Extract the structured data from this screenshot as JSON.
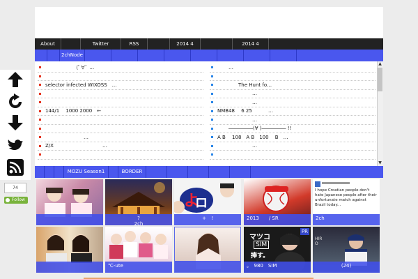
{
  "topnav": [
    "About",
    "",
    "Twitter",
    "RSS",
    "",
    "2014 4",
    "",
    "2014 4",
    ""
  ],
  "subnav": [
    "",
    "",
    "2chNode",
    "",
    "",
    "",
    "",
    "",
    "",
    "",
    "",
    ""
  ],
  "headlines": {
    "left": [
      "（ﾟ∀ﾟ …",
      "",
      "selector infected WIXOSS　…",
      "",
      "",
      "144/1　 1000 2000　←",
      "",
      "",
      "…",
      "Z/X　　　　　　　　　　…"
    ],
    "right": [
      "…",
      "",
      "The Hunt fo…",
      "…",
      "…",
      "NMB48　 6 25　　　 …",
      "…",
      "―――――(∀ )――――― !!",
      "A B　 108　A B　100　 B　…",
      "…"
    ]
  },
  "bottomnav": [
    "",
    "",
    "",
    "MOZU Season1",
    "",
    "BORDER",
    "",
    "",
    "",
    "",
    "",
    ""
  ],
  "tiles": [
    {
      "caption": "",
      "pr": ""
    },
    {
      "caption": "?\n2ch",
      "pr": ""
    },
    {
      "caption": "+　!",
      "pr": ""
    },
    {
      "caption": "2013　　/ SR",
      "pr": ""
    },
    {
      "caption": "2ch",
      "pr": "",
      "tweet": "I hope Croatian people don't hate Japanese people after their unfortunate match against Brazil today..."
    },
    {
      "caption": "",
      "pr": ""
    },
    {
      "caption": "℃-ute",
      "pr": ""
    },
    {
      "caption": "",
      "pr": ""
    },
    {
      "caption": "。　980　SIM",
      "pr": "PR",
      "sign1": "マツコ",
      "sign2": "SIM",
      "sign3": "捧す。"
    },
    {
      "caption": "(24)",
      "pr": "",
      "sign1": "HIRO"
    }
  ],
  "share": {
    "count": "74",
    "follow_label": "Follow"
  },
  "colors": {
    "accent": "#4a57ee",
    "navbar": "#222222",
    "bullet_left": "#e6321e",
    "bullet_right": "#2a86e8",
    "follow": "#79b33c"
  }
}
